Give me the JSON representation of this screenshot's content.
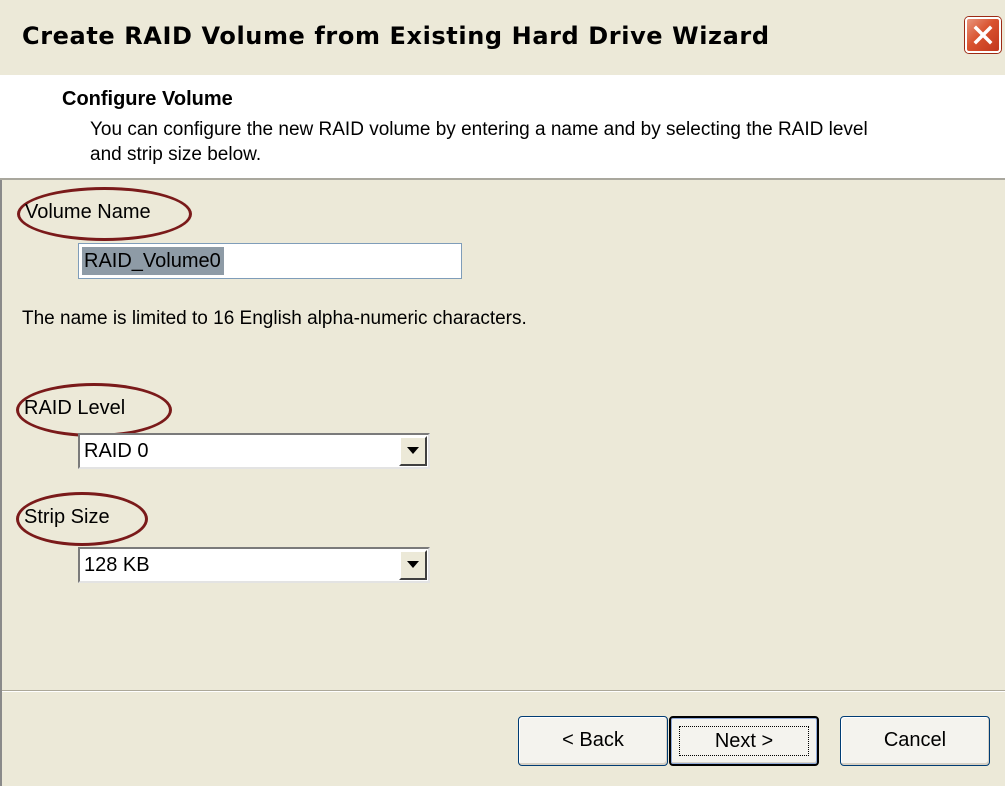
{
  "window": {
    "title": "Create RAID Volume from Existing Hard Drive Wizard",
    "close_icon": "close-icon"
  },
  "header": {
    "title": "Configure Volume",
    "description": "You can configure the new RAID volume by entering a name and by selecting the RAID level and strip size below."
  },
  "volume_name": {
    "label": "Volume Name",
    "value": "RAID_Volume0",
    "hint": "The name is limited to 16 English alpha-numeric characters."
  },
  "raid_level": {
    "label": "RAID Level",
    "value": "RAID 0"
  },
  "strip_size": {
    "label": "Strip Size",
    "value": "128 KB"
  },
  "buttons": {
    "back": "< Back",
    "next": "Next >",
    "cancel": "Cancel"
  },
  "colors": {
    "dialog_bg": "#ece9d8",
    "annotation_ellipse": "#7a1a1a",
    "close_button": "#d9532f"
  }
}
